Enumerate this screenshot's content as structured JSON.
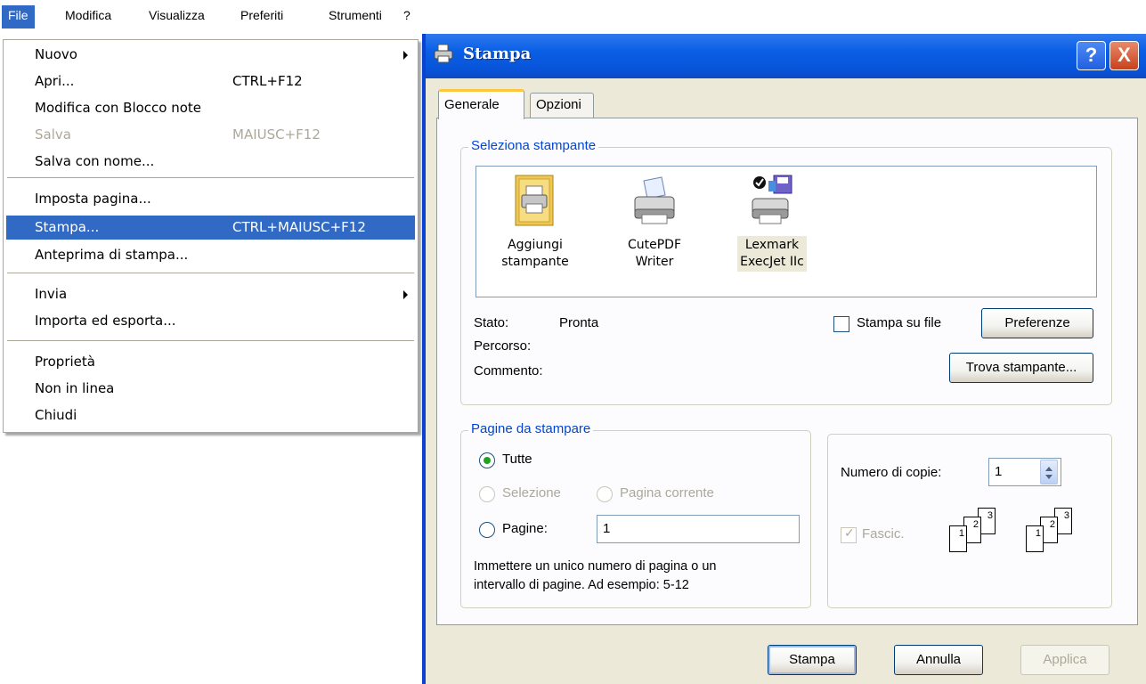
{
  "menubar": {
    "items": [
      "File",
      "Modifica",
      "Visualizza",
      "Preferiti",
      "Strumenti",
      "?"
    ]
  },
  "file_menu": {
    "items": [
      {
        "label": "Nuovo",
        "shortcut": "",
        "submenu": true
      },
      {
        "label": "Apri...",
        "shortcut": "CTRL+F12"
      },
      {
        "label": "Modifica con Blocco note",
        "shortcut": ""
      },
      {
        "label": "Salva",
        "shortcut": "MAIUSC+F12",
        "disabled": true
      },
      {
        "label": "Salva con nome...",
        "shortcut": ""
      },
      {
        "label": "Imposta pagina...",
        "shortcut": ""
      },
      {
        "label": "Stampa...",
        "shortcut": "CTRL+MAIUSC+F12",
        "highlighted": true
      },
      {
        "label": "Anteprima di stampa...",
        "shortcut": ""
      },
      {
        "label": "Invia",
        "shortcut": "",
        "submenu": true
      },
      {
        "label": "Importa ed esporta...",
        "shortcut": ""
      },
      {
        "label": "Proprietà",
        "shortcut": ""
      },
      {
        "label": "Non in linea",
        "shortcut": ""
      },
      {
        "label": "Chiudi",
        "shortcut": ""
      }
    ]
  },
  "dialog": {
    "title": "Stampa",
    "help_button": "?",
    "close_button": "X",
    "tabs": [
      "Generale",
      "Opzioni"
    ],
    "select_printer": {
      "legend": "Seleziona stampante",
      "printers": [
        {
          "label": "Aggiungi\nstampante",
          "icon": "add-printer-icon"
        },
        {
          "label": "CutePDF\nWriter",
          "icon": "printer-icon"
        },
        {
          "label": "Lexmark\nExecJet IIc",
          "icon": "default-printer-icon",
          "selected": true
        }
      ],
      "status_label": "Stato:",
      "status_value": "Pronta",
      "path_label": "Percorso:",
      "comment_label": "Commento:",
      "print_to_file_label": "Stampa su file",
      "print_to_file_checked": false,
      "preferences_button": "Preferenze",
      "find_printer_button": "Trova stampante..."
    },
    "page_range": {
      "legend": "Pagine da stampare",
      "all_label": "Tutte",
      "all_selected": true,
      "selection_label": "Selezione",
      "current_page_label": "Pagina corrente",
      "pages_label": "Pagine:",
      "pages_value": "1",
      "hint": "Immettere un unico numero di pagina o un\nintervallo di pagine. Ad esempio: 5-12"
    },
    "copies": {
      "count_label": "Numero di copie:",
      "count_value": "1",
      "collate_label": "Fascic.",
      "collate_checked": true,
      "collate_pages": [
        "1",
        "2",
        "3"
      ]
    },
    "buttons": {
      "print": "Stampa",
      "cancel": "Annulla",
      "apply": "Applica"
    }
  },
  "colors": {
    "menu_highlight": "#316ac5",
    "titlebar": "#0a5ee5",
    "dialog_bg": "#ece9d8",
    "group_legend": "#0046d5"
  }
}
